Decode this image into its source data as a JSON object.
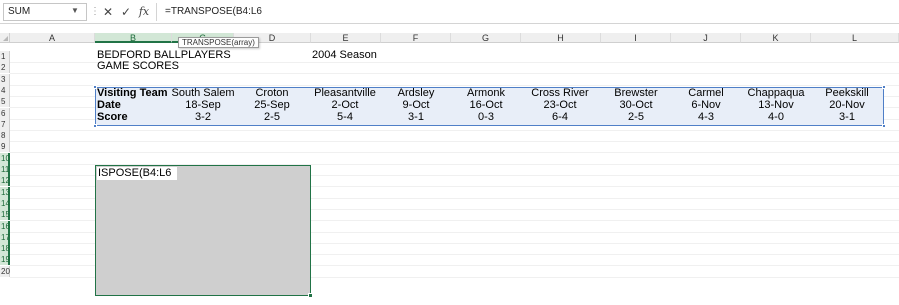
{
  "formula_bar": {
    "name_box": "SUM",
    "cancel_glyph": "✕",
    "enter_glyph": "✓",
    "fx_glyph": "fx",
    "formula": "=TRANSPOSE(B4:L6"
  },
  "tooltip": {
    "text": "TRANSPOSE(array)"
  },
  "columns": [
    "A",
    "B",
    "C",
    "D",
    "E",
    "F",
    "G",
    "H",
    "I",
    "J",
    "K",
    "L"
  ],
  "rows": [
    "1",
    "2",
    "3",
    "4",
    "5",
    "6",
    "7",
    "8",
    "9",
    "10",
    "11",
    "12",
    "13",
    "14",
    "15",
    "16",
    "17",
    "18",
    "19",
    "20"
  ],
  "header": {
    "title1": "BEDFORD BALLPLAYERS",
    "title2": "GAME SCORES",
    "season": "2004 Season"
  },
  "table": {
    "labels": [
      "Visiting Team",
      "Date",
      "Score"
    ],
    "teams": [
      "South Salem",
      "Croton",
      "Pleasantville",
      "Ardsley",
      "Armonk",
      "Cross River",
      "Brewster",
      "Carmel",
      "Chappaqua",
      "Peekskill"
    ],
    "dates": [
      "18-Sep",
      "25-Sep",
      "2-Oct",
      "9-Oct",
      "16-Oct",
      "23-Oct",
      "30-Oct",
      "6-Nov",
      "13-Nov",
      "20-Nov"
    ],
    "scores": [
      "3-2",
      "2-5",
      "5-4",
      "3-1",
      "0-3",
      "6-4",
      "2-5",
      "4-3",
      "4-0",
      "3-1"
    ]
  },
  "output_cell": {
    "text": "ISPOSE(B4:L6"
  },
  "colors": {
    "table_fill": "#e8eef8",
    "table_border": "#4f7fc7",
    "selection_green": "#217346",
    "output_fill": "#cfcfcf"
  }
}
